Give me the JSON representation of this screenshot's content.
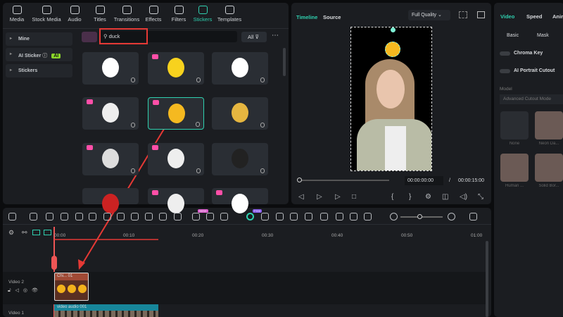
{
  "toolbar": [
    {
      "label": "Media",
      "icon": "media-icon"
    },
    {
      "label": "Stock Media",
      "icon": "stock-media-icon"
    },
    {
      "label": "Audio",
      "icon": "audio-icon"
    },
    {
      "label": "Titles",
      "icon": "titles-icon"
    },
    {
      "label": "Transitions",
      "icon": "transitions-icon"
    },
    {
      "label": "Effects",
      "icon": "effects-icon"
    },
    {
      "label": "Filters",
      "icon": "filters-icon"
    },
    {
      "label": "Stickers",
      "icon": "stickers-icon"
    },
    {
      "label": "Templates",
      "icon": "templates-icon"
    }
  ],
  "sidebar": {
    "items": [
      "Mine",
      "AI Sticker",
      "Stickers"
    ],
    "ai_badge": "AI"
  },
  "search": {
    "value": "duck",
    "filter": "All"
  },
  "preview": {
    "tabs": [
      "Timeline",
      "Source"
    ],
    "quality": "Full Quality",
    "current_time": "00:00:00:00",
    "separator": "/",
    "total_time": "00:00:15:00"
  },
  "properties": {
    "tabs": [
      "Video",
      "Speed",
      "Anim"
    ],
    "subtabs": [
      "Basic",
      "Mask"
    ],
    "chroma_key": "Chroma Key",
    "ai_portrait": "AI Portrait Cutout",
    "model_label": "Model",
    "model_value": "Advanced Cutout Mode",
    "presets": [
      "None",
      "Neon Da...",
      "Human ...",
      "Solid Bor..."
    ]
  },
  "timeline": {
    "ticks": [
      "00:00",
      "00:10",
      "00:20",
      "00:30",
      "00:40",
      "00:50",
      "01:00"
    ],
    "tracks": [
      "Video 2",
      "Video 1"
    ],
    "sticker_clip": "Chi... 01",
    "video_clip": "video audio 001",
    "new_badge": "NEW",
    "free_badge": "Free"
  },
  "colors": {
    "accent": "#2fd1b0",
    "annotation": "#e53935"
  }
}
